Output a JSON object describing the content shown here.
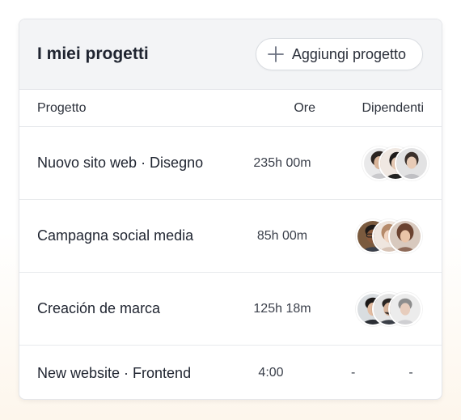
{
  "header": {
    "title": "I miei progetti",
    "add_button_label": "Aggiungi progetto"
  },
  "table": {
    "columns": [
      "Progetto",
      "Ore",
      "Dipendenti"
    ],
    "rows": [
      {
        "project": "Nuovo sito web · Disegno",
        "hours": "235h 00m",
        "employees": [
          "avatar-woman",
          "avatar-dark-hair",
          "avatar-light"
        ]
      },
      {
        "project": "Campagna social media",
        "hours": "85h 00m",
        "employees": [
          "avatar-man-glasses",
          "avatar-woman-light",
          "avatar-woman-brown"
        ]
      },
      {
        "project": "Creación de marca",
        "hours": "125h 18m",
        "employees": [
          "avatar-man-dark-hair",
          "avatar-man-beard",
          "avatar-man-grey"
        ]
      },
      {
        "project": "New website · Frontend",
        "hours": "4:00",
        "employees_placeholder": [
          "-",
          "-"
        ]
      }
    ]
  },
  "colors": {
    "header_bg": "#f3f4f6",
    "border": "#e4e6ea",
    "text": "#1f2430"
  }
}
